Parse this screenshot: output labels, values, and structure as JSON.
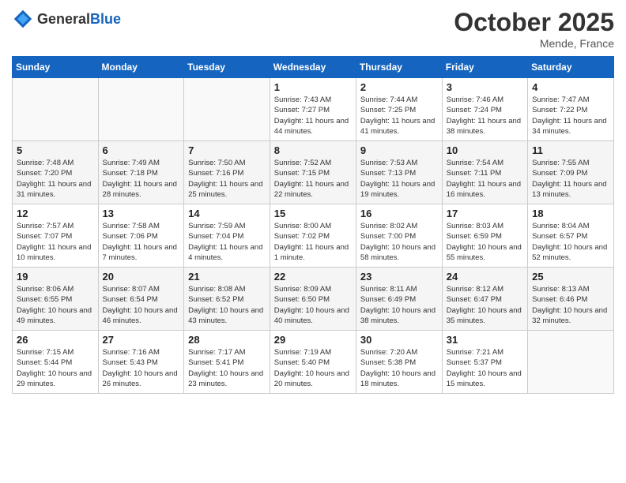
{
  "header": {
    "logo_general": "General",
    "logo_blue": "Blue",
    "month_title": "October 2025",
    "location": "Mende, France"
  },
  "days_of_week": [
    "Sunday",
    "Monday",
    "Tuesday",
    "Wednesday",
    "Thursday",
    "Friday",
    "Saturday"
  ],
  "weeks": [
    [
      {
        "day": "",
        "sunrise": "",
        "sunset": "",
        "daylight": ""
      },
      {
        "day": "",
        "sunrise": "",
        "sunset": "",
        "daylight": ""
      },
      {
        "day": "",
        "sunrise": "",
        "sunset": "",
        "daylight": ""
      },
      {
        "day": "1",
        "sunrise": "Sunrise: 7:43 AM",
        "sunset": "Sunset: 7:27 PM",
        "daylight": "Daylight: 11 hours and 44 minutes."
      },
      {
        "day": "2",
        "sunrise": "Sunrise: 7:44 AM",
        "sunset": "Sunset: 7:25 PM",
        "daylight": "Daylight: 11 hours and 41 minutes."
      },
      {
        "day": "3",
        "sunrise": "Sunrise: 7:46 AM",
        "sunset": "Sunset: 7:24 PM",
        "daylight": "Daylight: 11 hours and 38 minutes."
      },
      {
        "day": "4",
        "sunrise": "Sunrise: 7:47 AM",
        "sunset": "Sunset: 7:22 PM",
        "daylight": "Daylight: 11 hours and 34 minutes."
      }
    ],
    [
      {
        "day": "5",
        "sunrise": "Sunrise: 7:48 AM",
        "sunset": "Sunset: 7:20 PM",
        "daylight": "Daylight: 11 hours and 31 minutes."
      },
      {
        "day": "6",
        "sunrise": "Sunrise: 7:49 AM",
        "sunset": "Sunset: 7:18 PM",
        "daylight": "Daylight: 11 hours and 28 minutes."
      },
      {
        "day": "7",
        "sunrise": "Sunrise: 7:50 AM",
        "sunset": "Sunset: 7:16 PM",
        "daylight": "Daylight: 11 hours and 25 minutes."
      },
      {
        "day": "8",
        "sunrise": "Sunrise: 7:52 AM",
        "sunset": "Sunset: 7:15 PM",
        "daylight": "Daylight: 11 hours and 22 minutes."
      },
      {
        "day": "9",
        "sunrise": "Sunrise: 7:53 AM",
        "sunset": "Sunset: 7:13 PM",
        "daylight": "Daylight: 11 hours and 19 minutes."
      },
      {
        "day": "10",
        "sunrise": "Sunrise: 7:54 AM",
        "sunset": "Sunset: 7:11 PM",
        "daylight": "Daylight: 11 hours and 16 minutes."
      },
      {
        "day": "11",
        "sunrise": "Sunrise: 7:55 AM",
        "sunset": "Sunset: 7:09 PM",
        "daylight": "Daylight: 11 hours and 13 minutes."
      }
    ],
    [
      {
        "day": "12",
        "sunrise": "Sunrise: 7:57 AM",
        "sunset": "Sunset: 7:07 PM",
        "daylight": "Daylight: 11 hours and 10 minutes."
      },
      {
        "day": "13",
        "sunrise": "Sunrise: 7:58 AM",
        "sunset": "Sunset: 7:06 PM",
        "daylight": "Daylight: 11 hours and 7 minutes."
      },
      {
        "day": "14",
        "sunrise": "Sunrise: 7:59 AM",
        "sunset": "Sunset: 7:04 PM",
        "daylight": "Daylight: 11 hours and 4 minutes."
      },
      {
        "day": "15",
        "sunrise": "Sunrise: 8:00 AM",
        "sunset": "Sunset: 7:02 PM",
        "daylight": "Daylight: 11 hours and 1 minute."
      },
      {
        "day": "16",
        "sunrise": "Sunrise: 8:02 AM",
        "sunset": "Sunset: 7:00 PM",
        "daylight": "Daylight: 10 hours and 58 minutes."
      },
      {
        "day": "17",
        "sunrise": "Sunrise: 8:03 AM",
        "sunset": "Sunset: 6:59 PM",
        "daylight": "Daylight: 10 hours and 55 minutes."
      },
      {
        "day": "18",
        "sunrise": "Sunrise: 8:04 AM",
        "sunset": "Sunset: 6:57 PM",
        "daylight": "Daylight: 10 hours and 52 minutes."
      }
    ],
    [
      {
        "day": "19",
        "sunrise": "Sunrise: 8:06 AM",
        "sunset": "Sunset: 6:55 PM",
        "daylight": "Daylight: 10 hours and 49 minutes."
      },
      {
        "day": "20",
        "sunrise": "Sunrise: 8:07 AM",
        "sunset": "Sunset: 6:54 PM",
        "daylight": "Daylight: 10 hours and 46 minutes."
      },
      {
        "day": "21",
        "sunrise": "Sunrise: 8:08 AM",
        "sunset": "Sunset: 6:52 PM",
        "daylight": "Daylight: 10 hours and 43 minutes."
      },
      {
        "day": "22",
        "sunrise": "Sunrise: 8:09 AM",
        "sunset": "Sunset: 6:50 PM",
        "daylight": "Daylight: 10 hours and 40 minutes."
      },
      {
        "day": "23",
        "sunrise": "Sunrise: 8:11 AM",
        "sunset": "Sunset: 6:49 PM",
        "daylight": "Daylight: 10 hours and 38 minutes."
      },
      {
        "day": "24",
        "sunrise": "Sunrise: 8:12 AM",
        "sunset": "Sunset: 6:47 PM",
        "daylight": "Daylight: 10 hours and 35 minutes."
      },
      {
        "day": "25",
        "sunrise": "Sunrise: 8:13 AM",
        "sunset": "Sunset: 6:46 PM",
        "daylight": "Daylight: 10 hours and 32 minutes."
      }
    ],
    [
      {
        "day": "26",
        "sunrise": "Sunrise: 7:15 AM",
        "sunset": "Sunset: 5:44 PM",
        "daylight": "Daylight: 10 hours and 29 minutes."
      },
      {
        "day": "27",
        "sunrise": "Sunrise: 7:16 AM",
        "sunset": "Sunset: 5:43 PM",
        "daylight": "Daylight: 10 hours and 26 minutes."
      },
      {
        "day": "28",
        "sunrise": "Sunrise: 7:17 AM",
        "sunset": "Sunset: 5:41 PM",
        "daylight": "Daylight: 10 hours and 23 minutes."
      },
      {
        "day": "29",
        "sunrise": "Sunrise: 7:19 AM",
        "sunset": "Sunset: 5:40 PM",
        "daylight": "Daylight: 10 hours and 20 minutes."
      },
      {
        "day": "30",
        "sunrise": "Sunrise: 7:20 AM",
        "sunset": "Sunset: 5:38 PM",
        "daylight": "Daylight: 10 hours and 18 minutes."
      },
      {
        "day": "31",
        "sunrise": "Sunrise: 7:21 AM",
        "sunset": "Sunset: 5:37 PM",
        "daylight": "Daylight: 10 hours and 15 minutes."
      },
      {
        "day": "",
        "sunrise": "",
        "sunset": "",
        "daylight": ""
      }
    ]
  ]
}
